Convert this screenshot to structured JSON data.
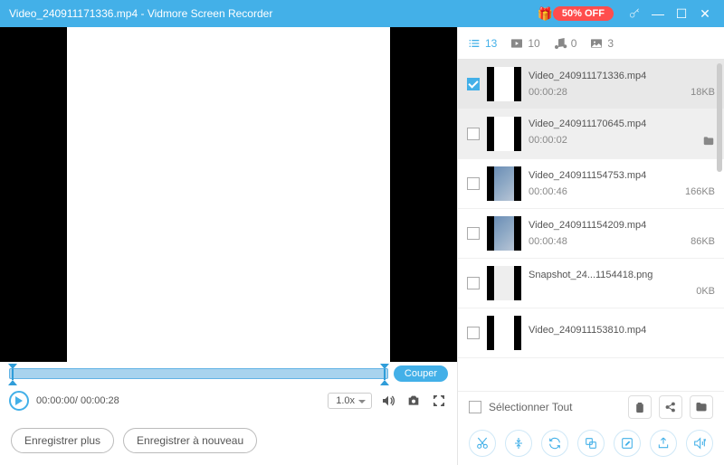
{
  "titlebar": {
    "filename": "Video_240911171336.mp4",
    "separator": "  -  ",
    "app": "Vidmore Screen Recorder",
    "promo": "50% OFF"
  },
  "timeline": {
    "cut_label": "Couper"
  },
  "controls": {
    "current": "00:00:00",
    "sep": "/ ",
    "total": "00:00:28",
    "speed": "1.0x"
  },
  "bottom": {
    "save_more": "Enregistrer plus",
    "save_again": "Enregistrer à nouveau"
  },
  "tabs": {
    "all_count": "13",
    "video_count": "10",
    "audio_count": "0",
    "image_count": "3"
  },
  "files": [
    {
      "name": "Video_240911171336.mp4",
      "dur": "00:00:28",
      "size": "18KB",
      "selected": true,
      "thumb": "vid"
    },
    {
      "name": "Video_240911170645.mp4",
      "dur": "00:00:02",
      "size": "",
      "folder": true,
      "thumb": "vid"
    },
    {
      "name": "Video_240911154753.mp4",
      "dur": "00:00:46",
      "size": "166KB",
      "thumb": "img"
    },
    {
      "name": "Video_240911154209.mp4",
      "dur": "00:00:48",
      "size": "86KB",
      "thumb": "img"
    },
    {
      "name": "Snapshot_24...1154418.png",
      "dur": "",
      "size": "0KB",
      "thumb": "snap"
    },
    {
      "name": "Video_240911153810.mp4",
      "dur": "",
      "size": "",
      "thumb": "vid"
    }
  ],
  "select_all": "Sélectionner Tout"
}
